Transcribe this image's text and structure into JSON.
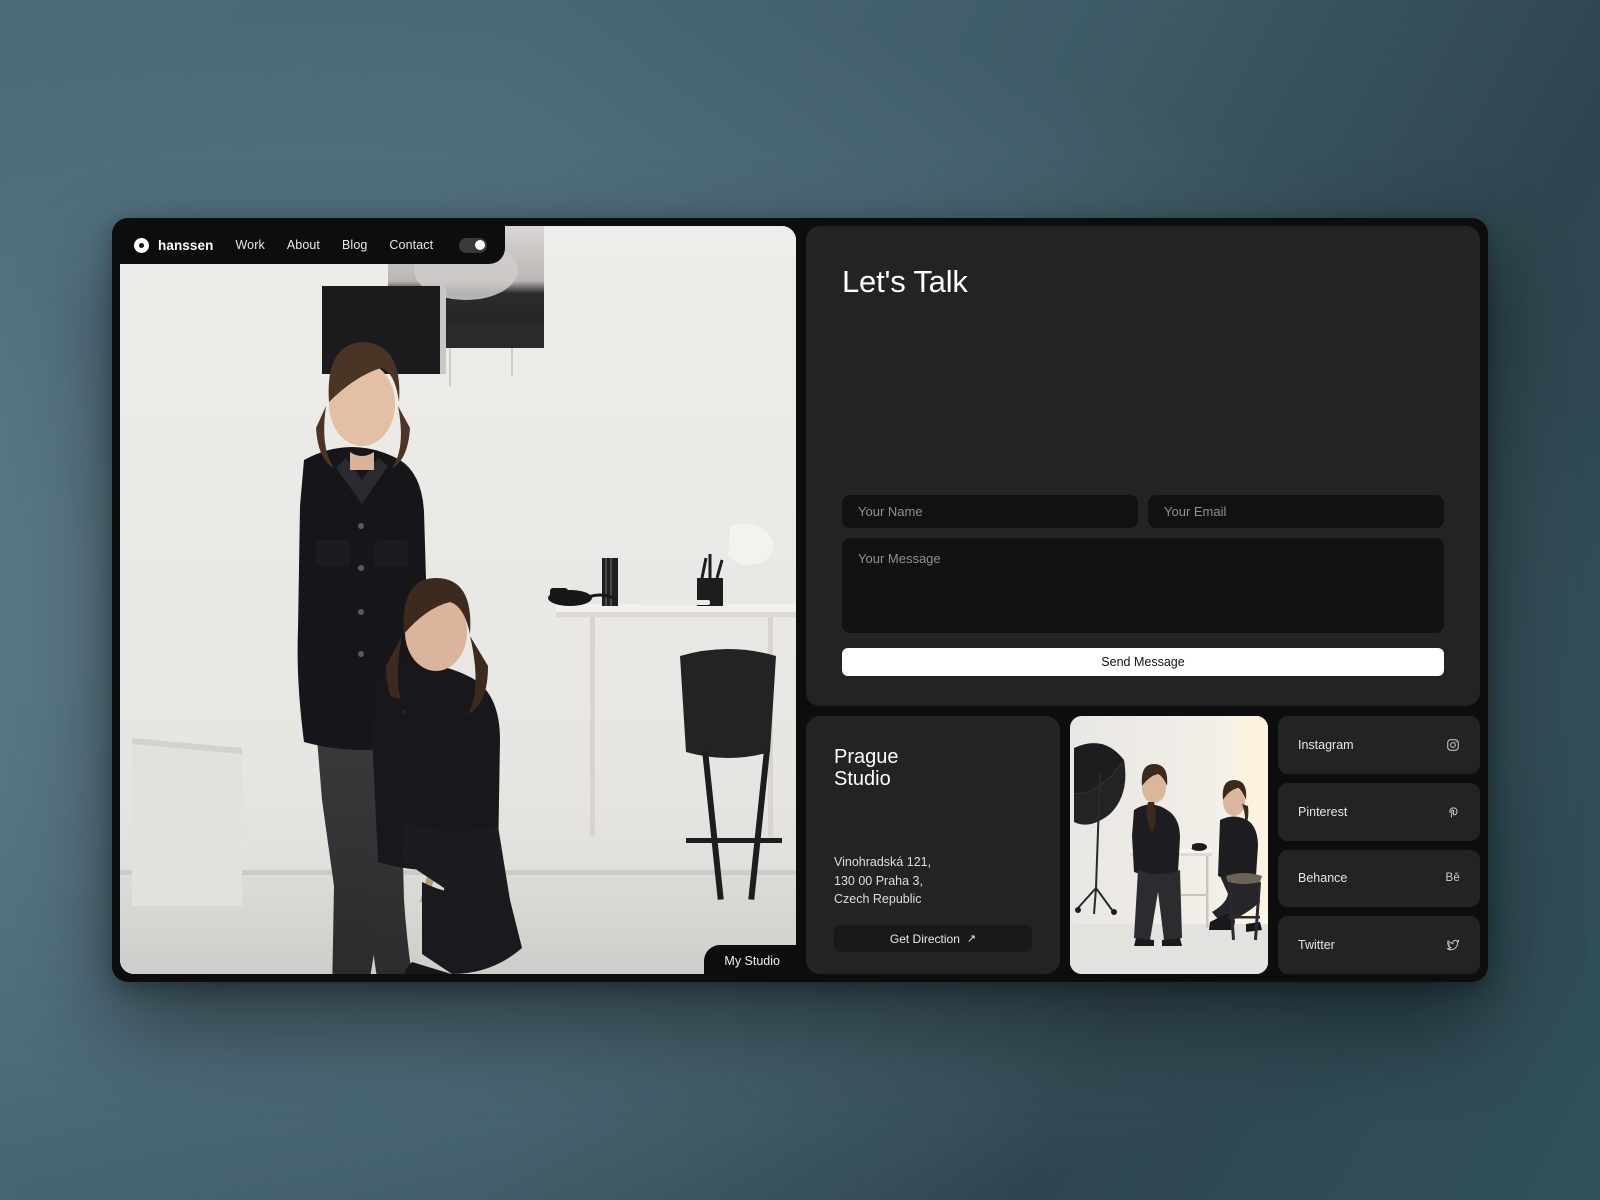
{
  "nav": {
    "logo_icon": "ring-logo-icon",
    "brand": "hanssen",
    "links": [
      "Work",
      "About",
      "Blog",
      "Contact"
    ],
    "toggle_state": "on"
  },
  "hero": {
    "studio_tab_label": "My Studio",
    "image_alt": "two women in black clothing in a bright minimal studio"
  },
  "contact": {
    "title": "Let's Talk",
    "fields": {
      "name_placeholder": "Your Name",
      "name_value": "",
      "email_placeholder": "Your Email",
      "email_value": "",
      "message_placeholder": "Your Message",
      "message_value": ""
    },
    "submit_label": "Send Message"
  },
  "address": {
    "title_line1": "Prague",
    "title_line2": "Studio",
    "line1": "Vinohradská 121,",
    "line2": "130 00 Praha 3,",
    "line3": "Czech Republic",
    "direction_label": "Get Direction",
    "direction_arrow": "↗"
  },
  "studio_photo": {
    "image_alt": "two women by a white table with a softbox umbrella"
  },
  "social": [
    {
      "label": "Instagram",
      "icon": "instagram-icon"
    },
    {
      "label": "Pinterest",
      "icon": "pinterest-icon"
    },
    {
      "label": "Behance",
      "icon": "behance-icon",
      "glyph": "Bē"
    },
    {
      "label": "Twitter",
      "icon": "twitter-icon"
    }
  ],
  "colors": {
    "frame": "#0d0d0e",
    "card": "#222325",
    "field": "#111112",
    "accent_button": "#ffffff",
    "text_primary": "#ffffff",
    "text_muted": "#8f9093",
    "page_background_light": "#4c6b78",
    "page_background_dark": "#2e464f"
  }
}
